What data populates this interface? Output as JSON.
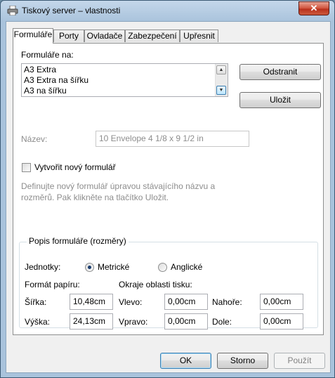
{
  "window": {
    "title": "Tiskový server – vlastnosti",
    "close_label": "✕"
  },
  "tabs": [
    {
      "label": "Formuláře"
    },
    {
      "label": "Porty"
    },
    {
      "label": "Ovladače"
    },
    {
      "label": "Zabezpečení"
    },
    {
      "label": "Upřesnit"
    }
  ],
  "forms_on": {
    "label": "Formuláře na:"
  },
  "forms_list": {
    "items": [
      "A3 Extra",
      "A3 Extra na šířku",
      "A3 na šířku"
    ]
  },
  "buttons": {
    "remove": "Odstranit",
    "save": "Uložit",
    "ok": "OK",
    "cancel": "Storno",
    "apply": "Použít"
  },
  "name_field": {
    "label": "Název:",
    "value": "10 Envelope 4 1/8 x 9 1/2 in"
  },
  "create_form": {
    "label": "Vytvořit nový formulář",
    "checked": false
  },
  "help_text": {
    "line1": "Definujte nový formulář úpravou stávajícího názvu a",
    "line2": "rozměrů. Pak klikněte na tlačítko Uložit."
  },
  "description": {
    "title": "Popis formuláře (rozměry)",
    "units_label": "Jednotky:",
    "metric_label": "Metrické",
    "english_label": "Anglické",
    "selected_unit": "Metrické",
    "paper_size_label": "Formát papíru:",
    "printer_area_label": "Okraje oblasti tisku:",
    "width_label": "Šířka:",
    "width_value": "10,48cm",
    "height_label": "Výška:",
    "height_value": "24,13cm",
    "left_label": "Vlevo:",
    "left_value": "0,00cm",
    "right_label": "Vpravo:",
    "right_value": "0,00cm",
    "top_label": "Nahoře:",
    "top_value": "0,00cm",
    "bottom_label": "Dole:",
    "bottom_value": "0,00cm"
  }
}
